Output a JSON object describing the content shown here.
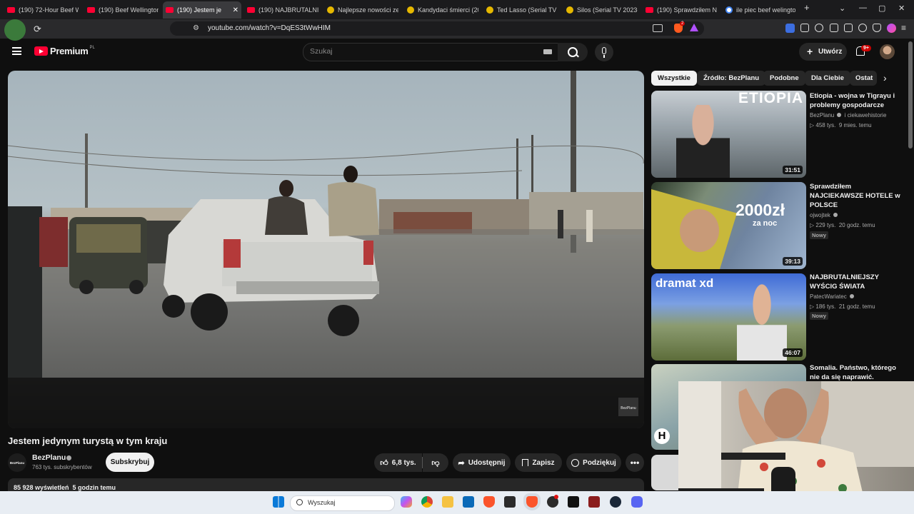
{
  "browser": {
    "tabs": [
      {
        "title": "(190) 72-Hour Beef W",
        "icon": "youtube-icon"
      },
      {
        "title": "(190) Beef Wellington",
        "icon": "youtube-icon"
      },
      {
        "title": "(190) Jestem je",
        "icon": "youtube-icon",
        "active": true
      },
      {
        "title": "(190) NAJBRUTALNIEJ",
        "icon": "youtube-icon"
      },
      {
        "title": "Najlepsze nowości ze",
        "icon": "biohazard-icon"
      },
      {
        "title": "Kandydaci śmierci (20",
        "icon": "biohazard-icon"
      },
      {
        "title": "Ted Lasso (Serial TV 2(",
        "icon": "biohazard-icon"
      },
      {
        "title": "Silos (Serial TV 2023-2",
        "icon": "biohazard-icon"
      },
      {
        "title": "(190) Sprawdziłem NA",
        "icon": "youtube-icon"
      },
      {
        "title": "ile piec beef welingto",
        "icon": "google-icon"
      }
    ],
    "new_tab": "+",
    "url": "youtube.com/watch?v=DqES3tWwHIM",
    "ext_badge": "2"
  },
  "youtube": {
    "logo_text": "Premium",
    "logo_region": "PL",
    "search_placeholder": "Szukaj",
    "create_label": "Utwórz",
    "notif_count": "9+",
    "video": {
      "title": "Jestem jedynym turystą w tym kraju",
      "watermark": "BezPlanu",
      "channel": "BezPlanu",
      "channel_avatar_text": "BezPlanu",
      "subs": "763 tys. subskrybentów",
      "subscribe": "Subskrybuj",
      "likes": "6,8 tys.",
      "share": "Udostępnij",
      "save": "Zapisz",
      "thanks": "Podziękuj",
      "views_line": "85 928 wyświetleń  5 godzin temu"
    },
    "chips": [
      "Wszystkie",
      "Źródło: BezPlanu",
      "Podobne",
      "Dla Ciebie",
      "Ostat"
    ],
    "related": [
      {
        "title": "Etiopia - wojna w Tigrayu i problemy gospodarcze",
        "channel": "BezPlanu",
        "channel_extra": "i ciekawehistorie",
        "meta": "458 tys.  9 mies. temu",
        "duration": "31:51",
        "thumb_text": "ETIOPIA",
        "new": ""
      },
      {
        "title": "Sprawdziłem NAJCIEKAWSZE HOTELE w POLSCE",
        "channel": "ojwojtek",
        "channel_extra": "",
        "meta": "229 tys.  20 godz. temu",
        "duration": "39:13",
        "thumb_text": "2000zł",
        "thumb_sub": "za noc",
        "new": "Nowy"
      },
      {
        "title": "NAJBRUTALNIEJSZY WYŚCIG ŚWIATA",
        "channel": "PatecWariatec",
        "channel_extra": "",
        "meta": "186 tys.  21 godz. temu",
        "duration": "46:07",
        "thumb_text": "dramat xd",
        "new": "Nowy"
      },
      {
        "title": "Somalia. Państwo, którego nie da się naprawić.",
        "channel": "",
        "channel_extra": "",
        "meta": "",
        "duration": "",
        "thumb_text": "",
        "new": ""
      }
    ]
  },
  "taskbar": {
    "search_placeholder": "Wyszukaj",
    "icons": [
      "windows-icon",
      "copilot-icon",
      "chrome-icon",
      "file-explorer-icon",
      "store-icon",
      "brave-icon",
      "app-icon",
      "brave-active-icon",
      "obs-icon",
      "ableton-icon",
      "game-icon",
      "steam-icon",
      "discord-icon"
    ]
  },
  "colors": {
    "accent": "#ff0033",
    "bg": "#0f0f0f",
    "chip": "#272727"
  }
}
